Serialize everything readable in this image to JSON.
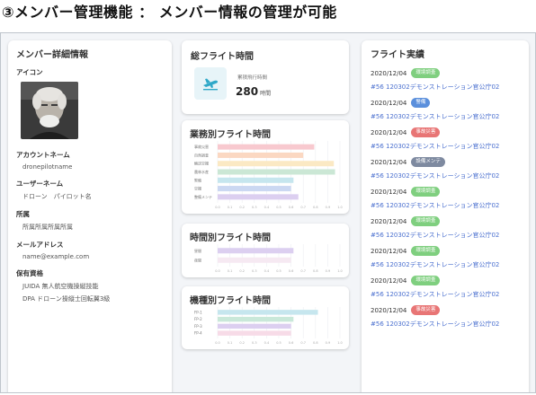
{
  "heading": "③メンバー管理機能 ： メンバー情報の管理が可能",
  "member": {
    "title": "メンバー詳細情報",
    "icon_label": "アイコン",
    "fields": [
      {
        "label": "アカウントネーム",
        "value": "dronepilotname"
      },
      {
        "label": "ユーザーネーム",
        "value": "ドローン　パイロット名"
      },
      {
        "label": "所属",
        "value": "所属所属所属所属"
      },
      {
        "label": "メールアドレス",
        "value": "name@example.com"
      }
    ],
    "qualifications_label": "保有資格",
    "qualifications": [
      "JUIDA 無人航空機操縦技能",
      "DPA ドローン操縦士回転翼3級"
    ]
  },
  "total": {
    "title": "総フライト時間",
    "label": "累積飛行時間",
    "value": "280",
    "unit": "時間",
    "icon": "airplane-takeoff-icon",
    "accent": "#2fa8c8"
  },
  "chart_data": [
    {
      "type": "bar",
      "orientation": "horizontal",
      "title": "業務別フライト時間",
      "categories": [
        "事故災害",
        "自然調査",
        "輸送空撮",
        "農林水産",
        "警備",
        "空撮",
        "整備メンテ"
      ],
      "values": [
        0.79,
        0.7,
        0.95,
        0.96,
        0.62,
        0.6,
        0.66
      ],
      "colors": [
        "#f8c9cf",
        "#fbd8c2",
        "#fbe9c4",
        "#cbe7d5",
        "#c6e6ee",
        "#cbd8f2",
        "#dccff0"
      ],
      "xlim": [
        0,
        1
      ],
      "grid": true
    },
    {
      "type": "bar",
      "orientation": "horizontal",
      "title": "時間別フライト時間",
      "categories": [
        "昼間",
        "夜間"
      ],
      "values": [
        0.62,
        0.6
      ],
      "colors": [
        "#dccff0",
        "#f6e9f2"
      ],
      "xlim": [
        0,
        1
      ],
      "grid": true
    },
    {
      "type": "bar",
      "orientation": "horizontal",
      "title": "機種別フライト時間",
      "categories": [
        "FP-1",
        "FP-2",
        "FP-3",
        "FP-4"
      ],
      "values": [
        0.82,
        0.62,
        0.6,
        0.6
      ],
      "colors": [
        "#c6e6ee",
        "#c9e8d9",
        "#dccff0",
        "#f7dbe7"
      ],
      "xlim": [
        0,
        1
      ],
      "grid": true
    }
  ],
  "flights": {
    "title": "フライト実績",
    "items": [
      {
        "date": "2020/12/04",
        "badge": "環境調査",
        "badge_color": "#7fcf7f",
        "name": "#56 120302デモンストレーション官公庁02"
      },
      {
        "date": "2020/12/04",
        "badge": "警備",
        "badge_color": "#5a8fdc",
        "name": "#56 120302デモンストレーション官公庁02"
      },
      {
        "date": "2020/12/04",
        "badge": "事故災害",
        "badge_color": "#e87575",
        "name": "#56 120302デモンストレーション官公庁02"
      },
      {
        "date": "2020/12/04",
        "badge": "設備メンテ",
        "badge_color": "#7e8aa0",
        "name": "#56 120302デモンストレーション官公庁02"
      },
      {
        "date": "2020/12/04",
        "badge": "環境調査",
        "badge_color": "#7fcf7f",
        "name": "#56 120302デモンストレーション官公庁02"
      },
      {
        "date": "2020/12/04",
        "badge": "環境調査",
        "badge_color": "#7fcf7f",
        "name": "#56 120302デモンストレーション官公庁02"
      },
      {
        "date": "2020/12/04",
        "badge": "環境調査",
        "badge_color": "#7fcf7f",
        "name": "#56 120302デモンストレーション官公庁02"
      },
      {
        "date": "2020/12/04",
        "badge": "環境調査",
        "badge_color": "#7fcf7f",
        "name": "#56 120302デモンストレーション官公庁02"
      },
      {
        "date": "2020/12/04",
        "badge": "事故災害",
        "badge_color": "#e87575",
        "name": "#56 120302デモンストレーション官公庁02"
      }
    ]
  }
}
